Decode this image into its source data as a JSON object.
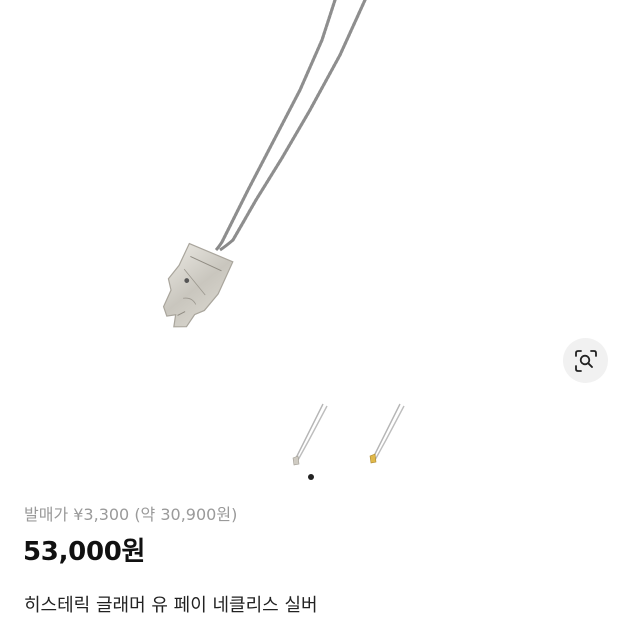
{
  "product": {
    "original_price": "발매가 ¥3,300 (약 30,900원)",
    "price": "53,000원",
    "title": "히스테릭 글래머 유 페이 네클리스 실버"
  },
  "gallery": {
    "thumbnails": [
      "silver-necklace-thumbnail",
      "gold-necklace-thumbnail"
    ],
    "active_index": 0,
    "page_count": 1
  },
  "icons": {
    "lens": "lens-search-icon"
  }
}
